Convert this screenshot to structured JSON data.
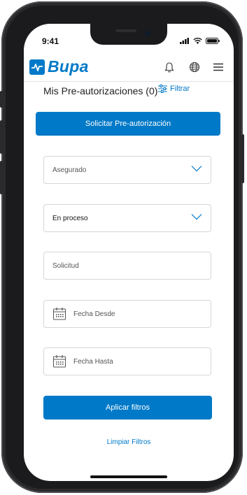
{
  "status": {
    "time": "9:41"
  },
  "header": {
    "logo_text": "Bupa",
    "bell_icon": "bell-icon",
    "globe_icon": "globe-icon",
    "menu_icon": "hamburger-menu-icon"
  },
  "page": {
    "title": "Mis Pre-autorizaciones (0)",
    "filter_label": "Filtrar"
  },
  "actions": {
    "request_label": "Solicitar Pre-autorización",
    "apply_label": "Aplicar filtros",
    "clear_label": "Limpiar Filtros"
  },
  "filters": {
    "insured": "Asegurado",
    "status": "En proceso",
    "request": "Solicitud",
    "date_from": "Fecha Desde",
    "date_to": "Fecha Hasta"
  },
  "colors": {
    "brand": "#0079c8",
    "frame": "#1b1b1d"
  }
}
